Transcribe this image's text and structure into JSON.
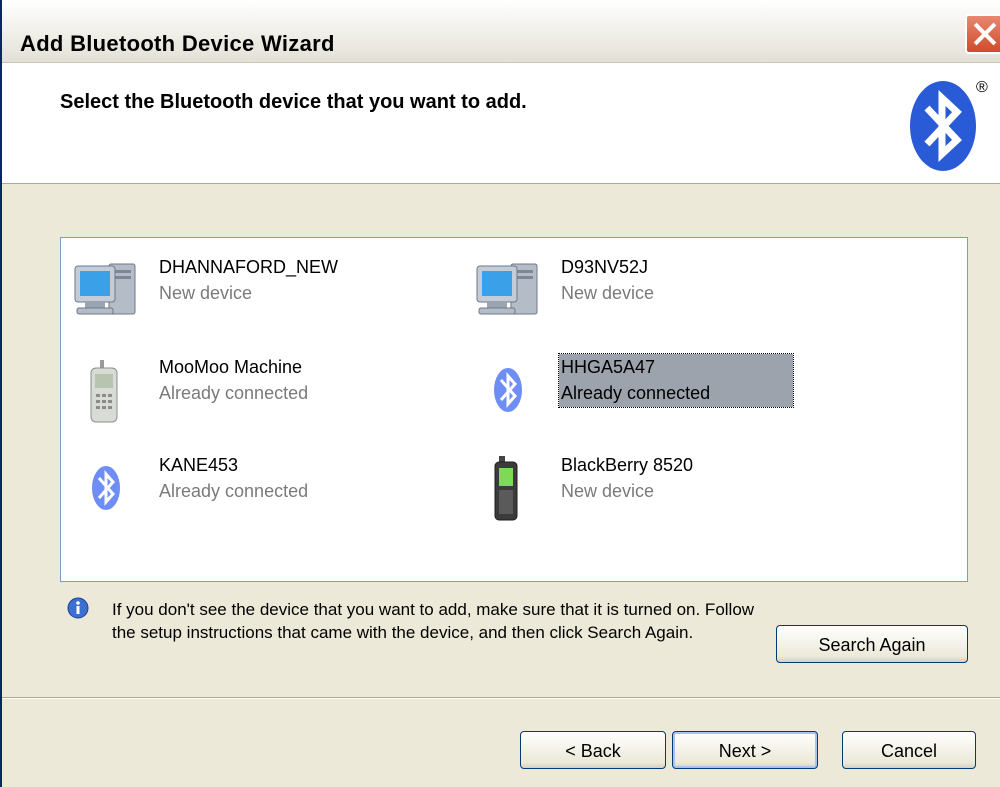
{
  "window": {
    "title": "Add Bluetooth Device Wizard"
  },
  "header": {
    "title": "Select the Bluetooth device that you want to add.",
    "logo_mark": "®"
  },
  "devices": [
    {
      "name": "DHANNAFORD_NEW",
      "status": "New device",
      "icon": "computer-icon",
      "selected": false
    },
    {
      "name": "D93NV52J",
      "status": "New device",
      "icon": "computer-icon",
      "selected": false
    },
    {
      "name": "MooMoo Machine",
      "status": "Already connected",
      "icon": "phone-icon",
      "selected": false
    },
    {
      "name": "HHGA5A47",
      "status": "Already connected",
      "icon": "bluetooth-icon",
      "selected": true
    },
    {
      "name": "KANE453",
      "status": "Already connected",
      "icon": "bluetooth-icon",
      "selected": false
    },
    {
      "name": "BlackBerry 8520",
      "status": "New device",
      "icon": "blackberry-icon",
      "selected": false
    }
  ],
  "info": {
    "text": "If you don't see the device that you want to add, make sure that it is turned on. Follow the setup instructions that came with the device, and then click Search Again."
  },
  "buttons": {
    "search_again": "Search Again",
    "back": "< Back",
    "next": "Next >",
    "cancel": "Cancel"
  },
  "colors": {
    "selection": "#9ca3ad",
    "bluetooth_blue": "#2a5bd7",
    "title_close": "#d04b2a"
  }
}
